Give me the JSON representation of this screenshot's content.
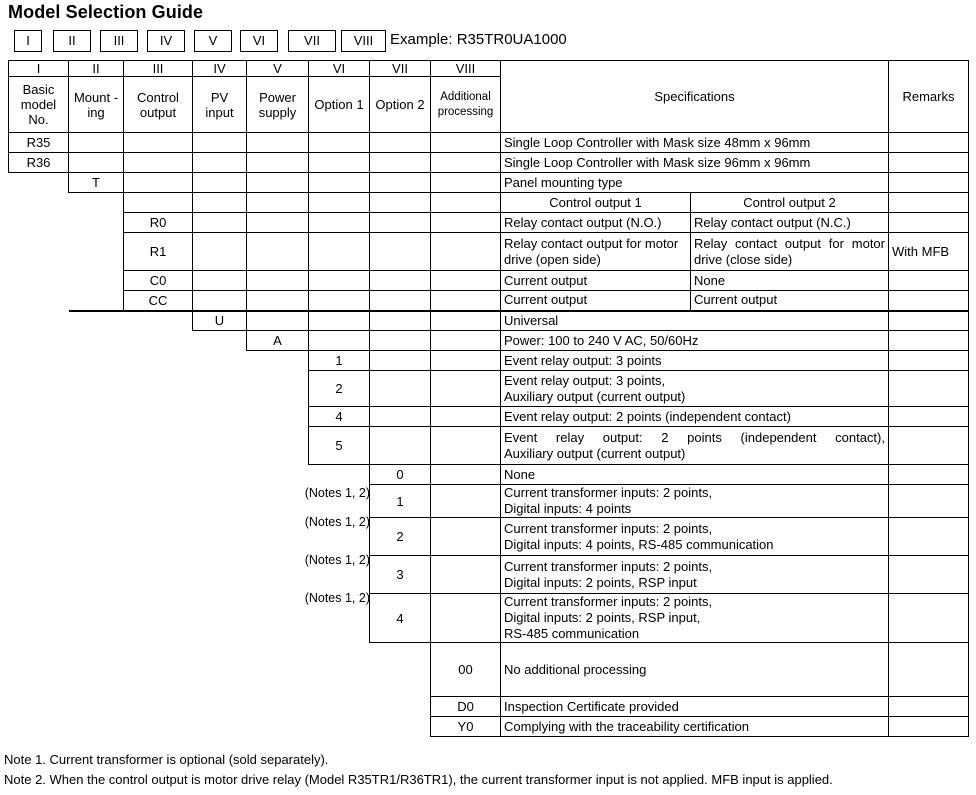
{
  "title": "Model Selection Guide",
  "key_boxes": [
    "I",
    "II",
    "III",
    "IV",
    "V",
    "VI",
    "VII",
    "VIII"
  ],
  "example": "Example: R35TR0UA1000",
  "table": {
    "roman_headers": [
      "I",
      "II",
      "III",
      "IV",
      "V",
      "VI",
      "VII",
      "VIII"
    ],
    "column_headers": [
      "Basic model No.",
      "Mount -ing",
      "Control output",
      "PV input",
      "Power supply",
      "Option 1",
      "Option 2",
      "Additional processing"
    ],
    "spec_header": "Specifications",
    "remarks_header": "Remarks",
    "subheader_output_1": "Control output 1",
    "subheader_output_2": "Control output 2",
    "rows": [
      {
        "col": 1,
        "code": "R35",
        "spec": "Single Loop Controller with Mask size 48mm x 96mm",
        "remark": ""
      },
      {
        "col": 1,
        "code": "R36",
        "spec": "Single Loop Controller with Mask size 96mm x 96mm",
        "remark": ""
      },
      {
        "col": 2,
        "code": "T",
        "spec": "Panel mounting type",
        "remark": ""
      },
      {
        "col": 3,
        "code": "R0",
        "spec1": "Relay contact output (N.O.)",
        "spec2": "Relay contact output (N.C.)",
        "remark": ""
      },
      {
        "col": 3,
        "code": "R1",
        "spec1": "Relay contact output for motor drive (open side)",
        "spec2": "Relay contact output for motor drive (close side)",
        "remark": "With MFB"
      },
      {
        "col": 3,
        "code": "C0",
        "spec1": "Current output",
        "spec2": "None",
        "remark": ""
      },
      {
        "col": 3,
        "code": "CC",
        "spec1": "Current output",
        "spec2": "Current output",
        "remark": ""
      },
      {
        "col": 4,
        "code": "U",
        "spec": "Universal",
        "remark": ""
      },
      {
        "col": 5,
        "code": "A",
        "spec": "Power: 100 to 240 V AC, 50/60Hz",
        "remark": ""
      },
      {
        "col": 6,
        "code": "1",
        "spec": "Event relay output: 3 points",
        "remark": ""
      },
      {
        "col": 6,
        "code": "2",
        "spec_lines": [
          "Event relay output: 3 points,",
          "Auxiliary output (current output)"
        ],
        "remark": ""
      },
      {
        "col": 6,
        "code": "4",
        "spec": "Event relay output: 2 points (independent contact)",
        "remark": ""
      },
      {
        "col": 6,
        "code": "5",
        "spec_lines": [
          "Event relay output: 2 points (independent contact),",
          "Auxiliary output (current output)"
        ],
        "justify": true,
        "remark": ""
      },
      {
        "col": 7,
        "code": "0",
        "spec": "None",
        "remark": ""
      },
      {
        "col": 7,
        "code": "1",
        "noteref": "(Notes 1, 2)",
        "spec_lines": [
          "Current transformer inputs: 2 points,",
          "Digital inputs: 4 points"
        ],
        "remark": ""
      },
      {
        "col": 7,
        "code": "2",
        "noteref": "(Notes 1, 2)",
        "spec_lines": [
          "Current transformer inputs: 2 points,",
          "Digital inputs: 4 points, RS-485 communication"
        ],
        "remark": ""
      },
      {
        "col": 7,
        "code": "3",
        "noteref": "(Notes 1, 2)",
        "spec_lines": [
          "Current transformer inputs: 2 points,",
          "Digital inputs: 2 points, RSP input"
        ],
        "remark": ""
      },
      {
        "col": 7,
        "code": "4",
        "noteref": "(Notes 1, 2)",
        "spec_lines": [
          "Current transformer inputs: 2 points,",
          "Digital inputs: 2 points, RSP input,",
          "RS-485 communication"
        ],
        "remark": ""
      },
      {
        "col": 8,
        "code": "00",
        "spec": "No additional processing",
        "remark": ""
      },
      {
        "col": 8,
        "code": "D0",
        "spec": "Inspection Certificate provided",
        "remark": ""
      },
      {
        "col": 8,
        "code": "Y0",
        "spec": "Complying with the traceability certification",
        "remark": ""
      }
    ]
  },
  "notes": [
    "Note 1. Current transformer is optional (sold separately).",
    "Note 2. When the control output is motor drive relay (Model R35TR1/R36TR1), the current transformer input is not applied. MFB input is applied."
  ]
}
